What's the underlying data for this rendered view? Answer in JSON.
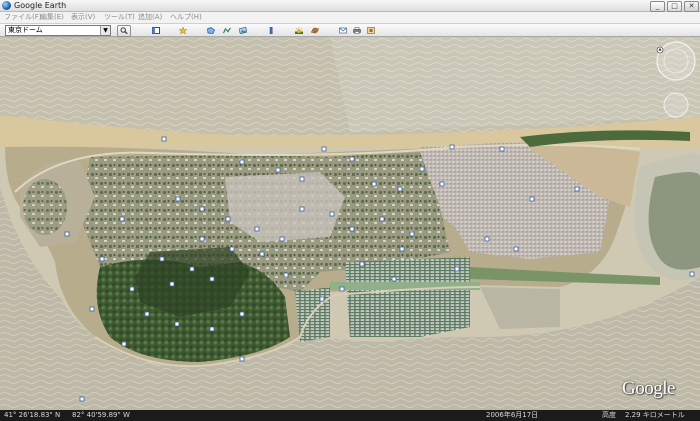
{
  "window": {
    "title": "Google Earth",
    "controls": {
      "minimize": "_",
      "maximize": "□",
      "close": "✕"
    }
  },
  "menu": {
    "items": [
      {
        "label": "ファイル(F)"
      },
      {
        "label": "編集(E)"
      },
      {
        "label": "表示(V)"
      },
      {
        "label": "ツール(T)"
      },
      {
        "label": "追加(A)"
      },
      {
        "label": "ヘルプ(H)"
      }
    ]
  },
  "toolbar": {
    "search_value": "東京ドーム",
    "dropdown_glyph": "▼",
    "buttons": [
      {
        "icon": "search-icon"
      },
      {
        "icon": "sidebar-toggle-icon"
      },
      {
        "icon": "placemark-icon"
      },
      {
        "icon": "polygon-icon"
      },
      {
        "icon": "path-icon"
      },
      {
        "icon": "image-overlay-icon"
      },
      {
        "icon": "ruler-icon"
      },
      {
        "icon": "sunlight-icon"
      },
      {
        "icon": "planets-icon"
      },
      {
        "icon": "email-icon"
      },
      {
        "icon": "print-icon"
      },
      {
        "icon": "map-view-icon"
      }
    ]
  },
  "status": {
    "latitude": "41° 26'18.83\" N",
    "longitude": "82° 40'59.89\" W",
    "imagery_date": "2006年6月17日",
    "altitude_label": "高度",
    "altitude_value": "2.29 キロメートル"
  },
  "brand": {
    "logo_text": "Google"
  }
}
